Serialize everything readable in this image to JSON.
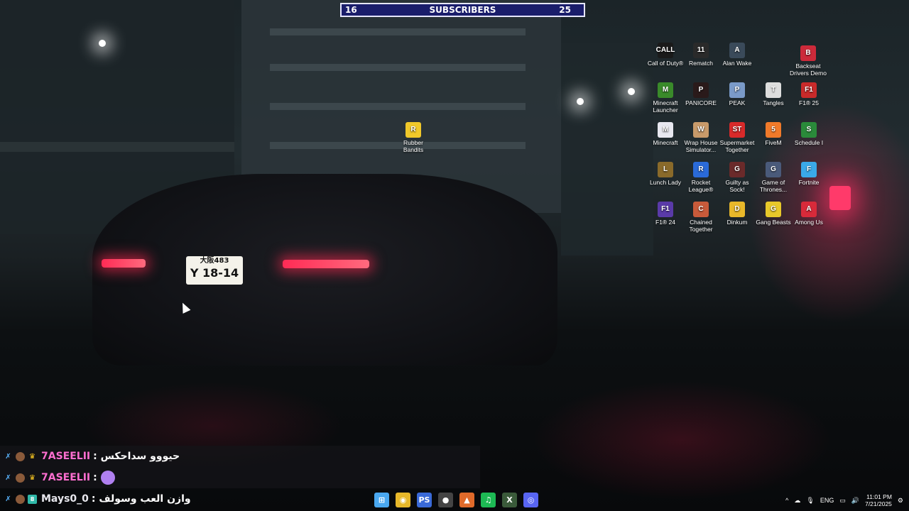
{
  "subscribers": {
    "current": "16",
    "label": "SUBSCRIBERS",
    "goal": "25"
  },
  "desktop_icons": [
    {
      "label": "Call of Duty®",
      "icon": "call-of-duty-icon",
      "color": "#1a1a1a",
      "glyph": "CALL"
    },
    {
      "label": "Rematch",
      "icon": "rematch-icon",
      "color": "#2a2a2a",
      "glyph": "11"
    },
    {
      "label": "Alan Wake",
      "icon": "alan-wake-icon",
      "color": "#3a4a5a",
      "glyph": "A"
    },
    {
      "label": "Backseat Drivers Demo",
      "icon": "backseat-drivers-icon",
      "color": "#cc2a3a",
      "glyph": "B"
    },
    {
      "label": "Minecraft Launcher",
      "icon": "minecraft-launcher-icon",
      "color": "#3a8a2a",
      "glyph": "M"
    },
    {
      "label": "PANICORE",
      "icon": "panicore-icon",
      "color": "#2a1a1a",
      "glyph": "P"
    },
    {
      "label": "PEAK",
      "icon": "peak-icon",
      "color": "#7a9ac8",
      "glyph": "P"
    },
    {
      "label": "Tangles",
      "icon": "tangles-icon",
      "color": "#dddddd",
      "glyph": "T"
    },
    {
      "label": "F1® 25",
      "icon": "f1-25-icon",
      "color": "#c82a2a",
      "glyph": "F1"
    },
    {
      "label": "Minecraft",
      "icon": "minecraft-file-icon",
      "color": "#e8e8f0",
      "glyph": "M"
    },
    {
      "label": "Wrap House Simulator...",
      "icon": "wrap-house-icon",
      "color": "#c89a6a",
      "glyph": "W"
    },
    {
      "label": "Supermarket Together",
      "icon": "supermarket-together-icon",
      "color": "#d82a2a",
      "glyph": "ST"
    },
    {
      "label": "FiveM",
      "icon": "fivem-icon",
      "color": "#f07a2a",
      "glyph": "5"
    },
    {
      "label": "Schedule I",
      "icon": "schedule-i-icon",
      "color": "#2a8a3a",
      "glyph": "S"
    },
    {
      "label": "Lunch Lady",
      "icon": "lunch-lady-icon",
      "color": "#8a6a2a",
      "glyph": "L"
    },
    {
      "label": "Rocket League®",
      "icon": "rocket-league-icon",
      "color": "#2a6ad8",
      "glyph": "R"
    },
    {
      "label": "Guilty as Sock!",
      "icon": "guilty-as-sock-icon",
      "color": "#6a2a2a",
      "glyph": "G"
    },
    {
      "label": "Game of Thrones...",
      "icon": "game-of-thrones-icon",
      "color": "#4a5a7a",
      "glyph": "G"
    },
    {
      "label": "Fortnite",
      "icon": "fortnite-icon",
      "color": "#3aa8e8",
      "glyph": "F"
    },
    {
      "label": "F1® 24",
      "icon": "f1-24-icon",
      "color": "#5a3aa8",
      "glyph": "F1"
    },
    {
      "label": "Chained Together",
      "icon": "chained-together-icon",
      "color": "#c85a3a",
      "glyph": "C"
    },
    {
      "label": "Dinkum",
      "icon": "dinkum-icon",
      "color": "#e8b82a",
      "glyph": "D"
    },
    {
      "label": "Gang Beasts",
      "icon": "gang-beasts-icon",
      "color": "#e8c82a",
      "glyph": "G"
    },
    {
      "label": "Among Us",
      "icon": "among-us-icon",
      "color": "#d82a3a",
      "glyph": "A"
    },
    {
      "label": "Rubber Bandits",
      "icon": "rubber-bandits-icon",
      "color": "#f0c82a",
      "glyph": "R"
    }
  ],
  "chat": [
    {
      "user": "7ASEELII",
      "message": "حيووو سداحكس",
      "emote": false,
      "user_color": "pink"
    },
    {
      "user": "7ASEELII",
      "message": "",
      "emote": true,
      "user_color": "pink"
    },
    {
      "user": "Mays0_0",
      "message": "وازن العب وسولف",
      "emote": false,
      "user_color": "white"
    }
  ],
  "chat_separator": ":",
  "taskbar": {
    "apps": [
      {
        "name": "start-button",
        "glyph": "⊞",
        "color": "#4aa8f0"
      },
      {
        "name": "chrome-icon",
        "glyph": "◉",
        "color": "#e8b82a"
      },
      {
        "name": "ps-remote-icon",
        "glyph": "PS",
        "color": "#3a6ad8"
      },
      {
        "name": "obs-icon",
        "glyph": "●",
        "color": "#444"
      },
      {
        "name": "brave-icon",
        "glyph": "▲",
        "color": "#e06a2a"
      },
      {
        "name": "spotify-icon",
        "glyph": "♫",
        "color": "#1db954"
      },
      {
        "name": "xbox-icon",
        "glyph": "X",
        "color": "#3a5a3a"
      },
      {
        "name": "discord-icon",
        "glyph": "◎",
        "color": "#5865f2"
      }
    ],
    "tray": {
      "chevron": "^",
      "language": "ENG",
      "time": "11:01 PM",
      "date": "7/21/2025"
    }
  },
  "plate": {
    "top": "大阪483",
    "bottom": "Y 18-14"
  }
}
